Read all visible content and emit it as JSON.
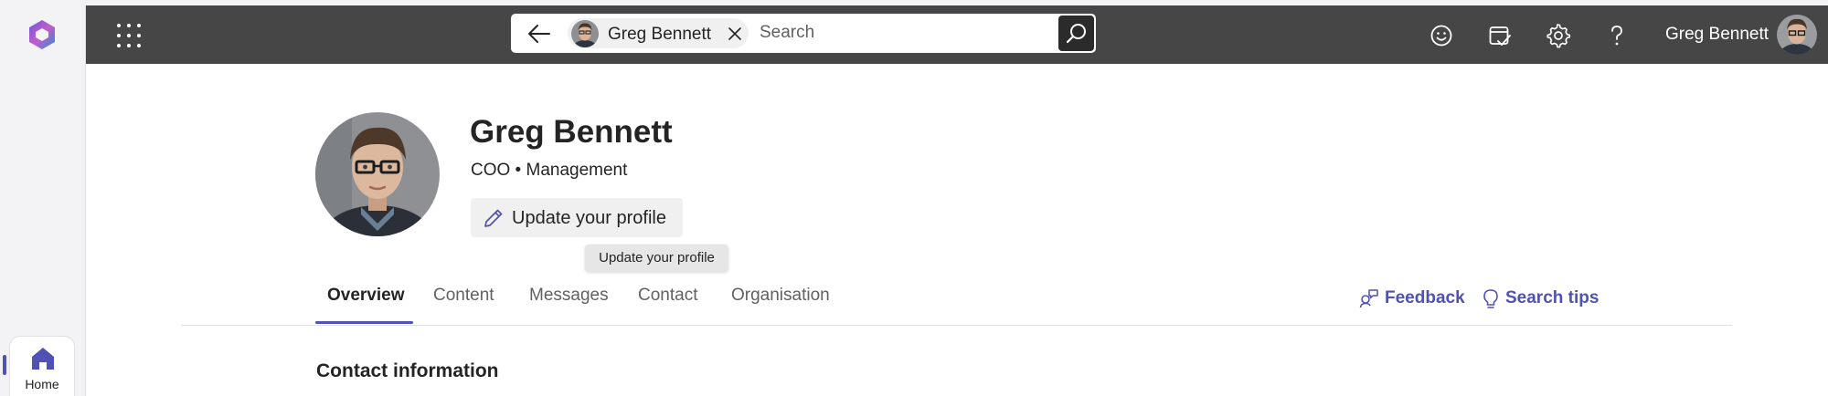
{
  "rail": {
    "home_label": "Home"
  },
  "topbar": {
    "search": {
      "person_chip": "Greg Bennett",
      "placeholder": "Search"
    },
    "user_name": "Greg Bennett"
  },
  "profile": {
    "name": "Greg Bennett",
    "subtitle": "COO • Management",
    "update_button": "Update your profile",
    "tooltip": "Update your profile"
  },
  "tabs": [
    {
      "label": "Overview",
      "active": true
    },
    {
      "label": "Content",
      "active": false
    },
    {
      "label": "Messages",
      "active": false
    },
    {
      "label": "Contact",
      "active": false
    },
    {
      "label": "Organisation",
      "active": false
    }
  ],
  "actions": {
    "feedback": "Feedback",
    "search_tips": "Search tips"
  },
  "section": {
    "title": "Contact information"
  },
  "colors": {
    "accent": "#4f52b2",
    "topbar": "#464646"
  }
}
